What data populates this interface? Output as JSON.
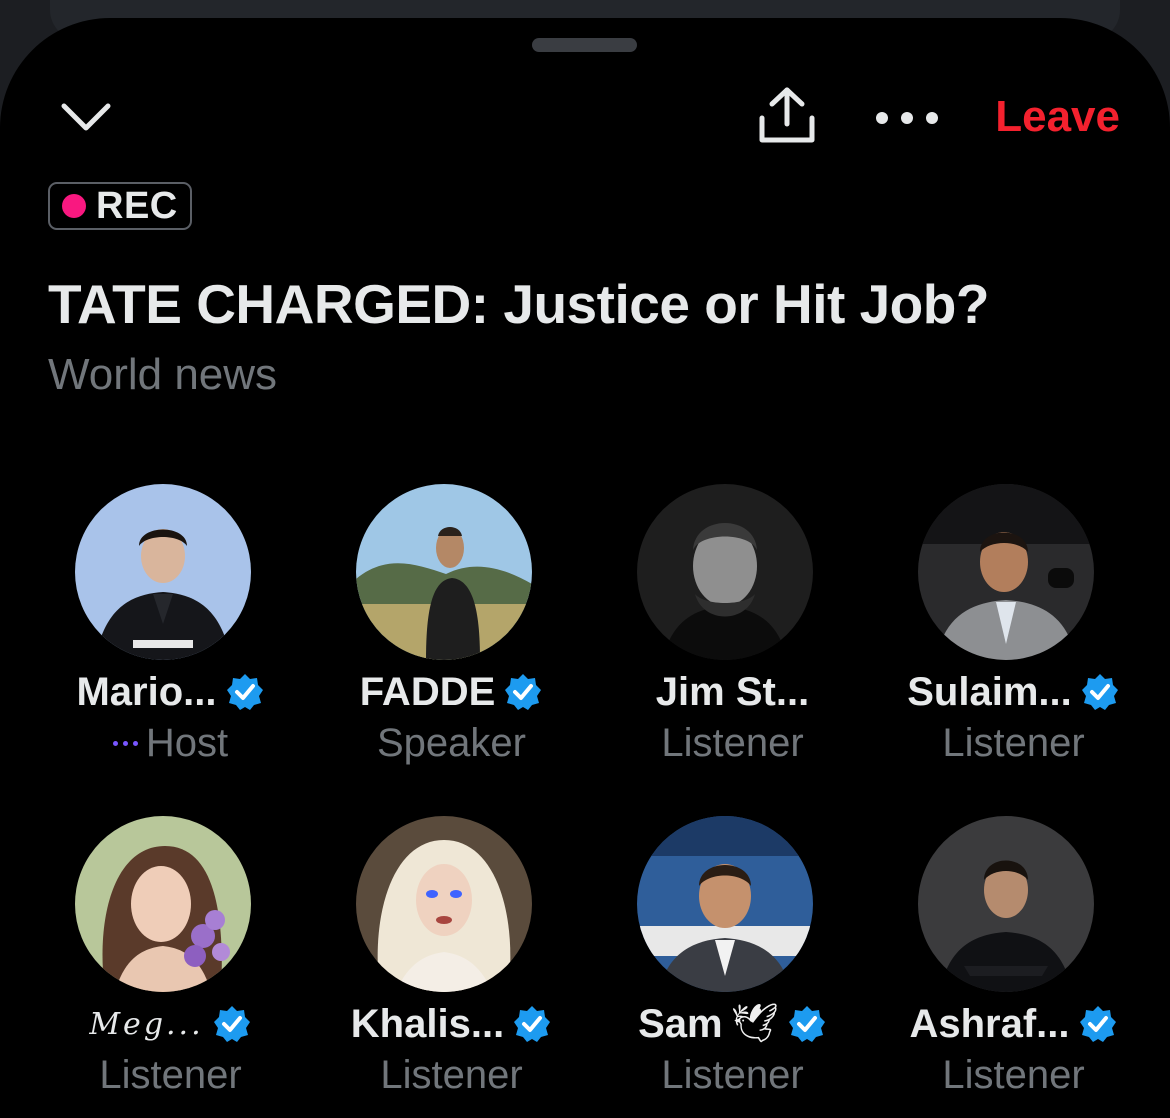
{
  "header": {
    "leave_label": "Leave",
    "rec_label": "REC",
    "title": "TATE CHARGED: Justice or Hit Job?",
    "topic": "World news"
  },
  "colors": {
    "leave": "#f4212e",
    "rec_dot": "#f91880",
    "verified": "#1d9bf0",
    "speaking": "#7856ff",
    "secondary_text": "#71767b"
  },
  "icons": {
    "collapse": "chevron-down-icon",
    "share": "share-icon",
    "more": "more-horizontal-icon",
    "verified": "verified-badge-icon"
  },
  "participants": [
    {
      "name": "Mario...",
      "role": "Host",
      "verified": true,
      "speaking": true
    },
    {
      "name": "FADDE",
      "role": "Speaker",
      "verified": true
    },
    {
      "name": "Jim St...",
      "role": "Listener",
      "verified": false
    },
    {
      "name": "Sulaim...",
      "role": "Listener",
      "verified": true
    },
    {
      "name": "𝑀𝑒𝑔...",
      "role": "Listener",
      "verified": true
    },
    {
      "name": "Khalis...",
      "role": "Listener",
      "verified": true
    },
    {
      "name": "Sam",
      "emoji": "🕊",
      "role": "Listener",
      "verified": true
    },
    {
      "name": "Ashraf...",
      "role": "Listener",
      "verified": true
    }
  ]
}
